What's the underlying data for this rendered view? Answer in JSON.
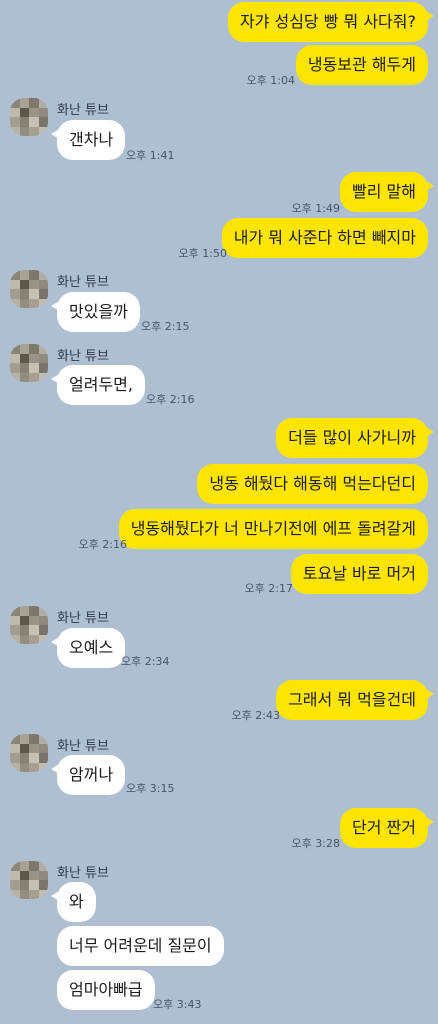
{
  "colors": {
    "background": "#aebfd2",
    "my_bubble": "#fee500",
    "their_bubble": "#ffffff"
  },
  "contact": {
    "name": "화난 튜브",
    "avatar_icon": "pixelated-avatar-icon"
  },
  "messages": [
    {
      "from": "me",
      "text": "자갸 성심당 빵 뭐 사다줘?",
      "time": ""
    },
    {
      "from": "me",
      "text": "냉동보관 해두게",
      "time": "오후 1:04"
    },
    {
      "from": "them",
      "text": "갠차나",
      "time": "오후 1:41"
    },
    {
      "from": "me",
      "text": "빨리 말해",
      "time": "오후 1:49"
    },
    {
      "from": "me",
      "text": "내가 뭐 사준다 하면 빼지마",
      "time": "오후 1:50"
    },
    {
      "from": "them",
      "text": "맛있을까",
      "time": "오후 2:15"
    },
    {
      "from": "them",
      "text": "얼려두면,",
      "time": "오후 2:16"
    },
    {
      "from": "me",
      "text": "더들 많이 사가니까",
      "time": ""
    },
    {
      "from": "me",
      "text": "냉동 해뒀다 해동해 먹는다던디",
      "time": ""
    },
    {
      "from": "me",
      "text": "냉동해뒀다가 너 만나기전에 에프 돌려갈게",
      "time": "오후 2:16"
    },
    {
      "from": "me",
      "text": "토요날 바로 머거",
      "time": "오후 2:17"
    },
    {
      "from": "them",
      "text": "오예스",
      "time": "오후 2:34"
    },
    {
      "from": "me",
      "text": "그래서 뭐 먹을건데",
      "time": "오후 2:43"
    },
    {
      "from": "them",
      "text": "암꺼나",
      "time": "오후 3:15"
    },
    {
      "from": "me",
      "text": "단거 짠거",
      "time": "오후 3:28"
    },
    {
      "from": "them",
      "text": "와",
      "time": ""
    },
    {
      "from": "them",
      "text": "너무 어려운데 질문이",
      "time": ""
    },
    {
      "from": "them",
      "text": "엄마아빠급",
      "time": "오후 3:43"
    }
  ]
}
